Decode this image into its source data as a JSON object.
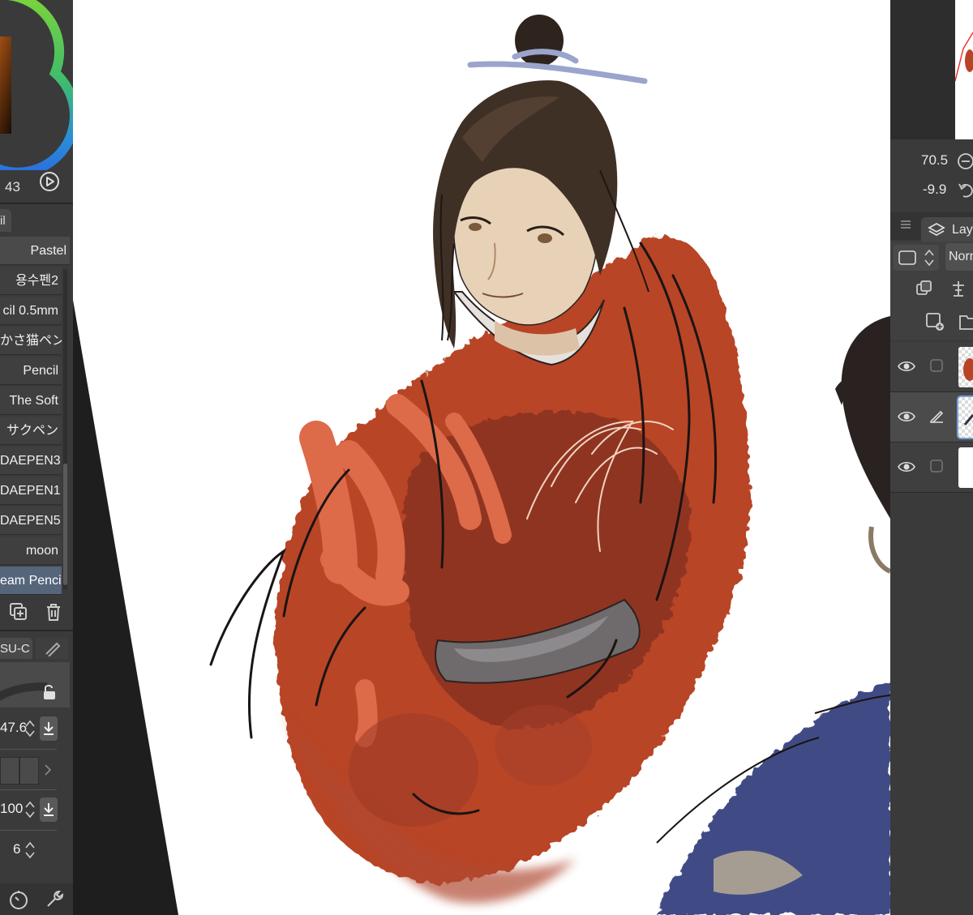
{
  "colors": {
    "panel_bg": "#3a3a3a",
    "selected_brush": "#55657a",
    "canvas_bg": "#ffffff",
    "robe_red": "#b84428",
    "robe_light": "#d86a4a",
    "hair": "#3f3026",
    "skin": "#e6d2ba",
    "blue_cloth": "#3f4c86"
  },
  "color_panel": {
    "value": "43",
    "play_icon": "play-circle-icon"
  },
  "sub_tool": {
    "tab_label": "il",
    "brushes": [
      {
        "label": "Pastel"
      },
      {
        "label": "용수펜2"
      },
      {
        "label": "cil 0.5mm"
      },
      {
        "label": "かさ猫ペン"
      },
      {
        "label": "Pencil"
      },
      {
        "label": "The Soft"
      },
      {
        "label": "サクペン"
      },
      {
        "label": "DAEPEN3"
      },
      {
        "label": "DAEPEN1"
      },
      {
        "label": "DAEPEN5"
      },
      {
        "label": "moon"
      },
      {
        "label": "eam Pencil"
      }
    ],
    "selected_index": 11,
    "duplicate_icon": "duplicate-icon",
    "delete_icon": "trash-icon"
  },
  "tool_property": {
    "tab_label": "SU-C",
    "brush_size": "47.6",
    "opacity": "100",
    "stabilization": "6",
    "lock_icon": "lock-icon"
  },
  "bottom_tools": {
    "left_icon": "timer-icon",
    "right_icon": "wrench-icon"
  },
  "navigator": {
    "zoom": "70.5",
    "rotation": "-9.9"
  },
  "layer_panel": {
    "tab_label": "Lay",
    "blend_mode": "Norn",
    "layers": [
      {
        "visible": true,
        "editing": false
      },
      {
        "visible": true,
        "editing": true
      },
      {
        "visible": true,
        "editing": false
      }
    ],
    "selected_index": 1
  }
}
